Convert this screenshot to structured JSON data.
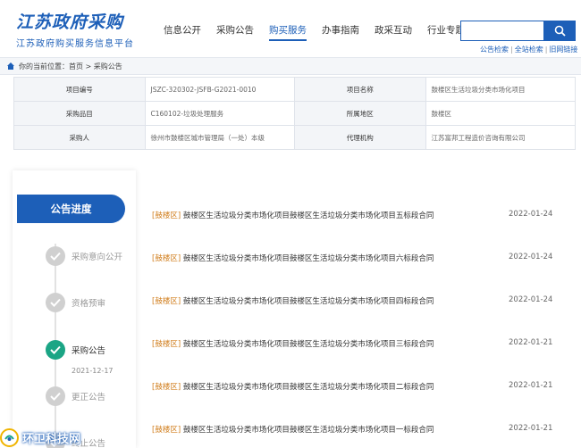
{
  "header": {
    "logo_calligraphy": "江苏政府采购",
    "logo_subtitle": "江苏政府购买服务信息平台",
    "nav": [
      "信息公开",
      "采购公告",
      "购买服务",
      "办事指南",
      "政采互动",
      "行业专题"
    ],
    "active_nav_index": 2,
    "search": {
      "value": "",
      "placeholder": ""
    },
    "quicklinks": [
      "公告检索",
      "全站检索",
      "旧网链接"
    ]
  },
  "breadcrumb": {
    "prefix": "你的当前位置：",
    "path": "首页 > 采购公告"
  },
  "info": [
    [
      "项目编号",
      "JSZC-320302-JSFB-G2021-0010",
      "项目名称",
      "鼓楼区生活垃圾分类市场化项目"
    ],
    [
      "采购品目",
      "C160102-垃圾处理服务",
      "所属地区",
      "鼓楼区"
    ],
    [
      "采购人",
      "徐州市鼓楼区城市管理局（一处）本级",
      "代理机构",
      "江苏富邦工程造价咨询有限公司"
    ]
  ],
  "progress": {
    "heading": "公告进度",
    "steps": [
      {
        "label": "采购意向公开",
        "date": "",
        "active": false
      },
      {
        "label": "资格预审",
        "date": "",
        "active": false
      },
      {
        "label": "采购公告",
        "date": "2021-12-17",
        "active": true
      },
      {
        "label": "更正公告",
        "date": "",
        "active": false
      },
      {
        "label": "终止公告",
        "date": "",
        "active": false
      }
    ]
  },
  "announcements": [
    {
      "region": "[鼓楼区]",
      "title": "鼓楼区生活垃圾分类市场化项目鼓楼区生活垃圾分类市场化项目五标段合同",
      "date": "2022-01-24"
    },
    {
      "region": "[鼓楼区]",
      "title": "鼓楼区生活垃圾分类市场化项目鼓楼区生活垃圾分类市场化项目六标段合同",
      "date": "2022-01-24"
    },
    {
      "region": "[鼓楼区]",
      "title": "鼓楼区生活垃圾分类市场化项目鼓楼区生活垃圾分类市场化项目四标段合同",
      "date": "2022-01-24"
    },
    {
      "region": "[鼓楼区]",
      "title": "鼓楼区生活垃圾分类市场化项目鼓楼区生活垃圾分类市场化项目三标段合同",
      "date": "2022-01-21"
    },
    {
      "region": "[鼓楼区]",
      "title": "鼓楼区生活垃圾分类市场化项目鼓楼区生活垃圾分类市场化项目二标段合同",
      "date": "2022-01-21"
    },
    {
      "region": "[鼓楼区]",
      "title": "鼓楼区生活垃圾分类市场化项目鼓楼区生活垃圾分类市场化项目一标段合同",
      "date": "2022-01-21"
    }
  ],
  "watermark": {
    "text": "环卫科技网"
  },
  "colors": {
    "brand_blue": "#1d5fb8",
    "active_green": "#1ba585",
    "region_orange": "#d07c1a",
    "inactive_gray": "#d0d0d0"
  },
  "icons": {
    "search": "search-icon",
    "home": "home-icon",
    "check": "check-icon"
  }
}
